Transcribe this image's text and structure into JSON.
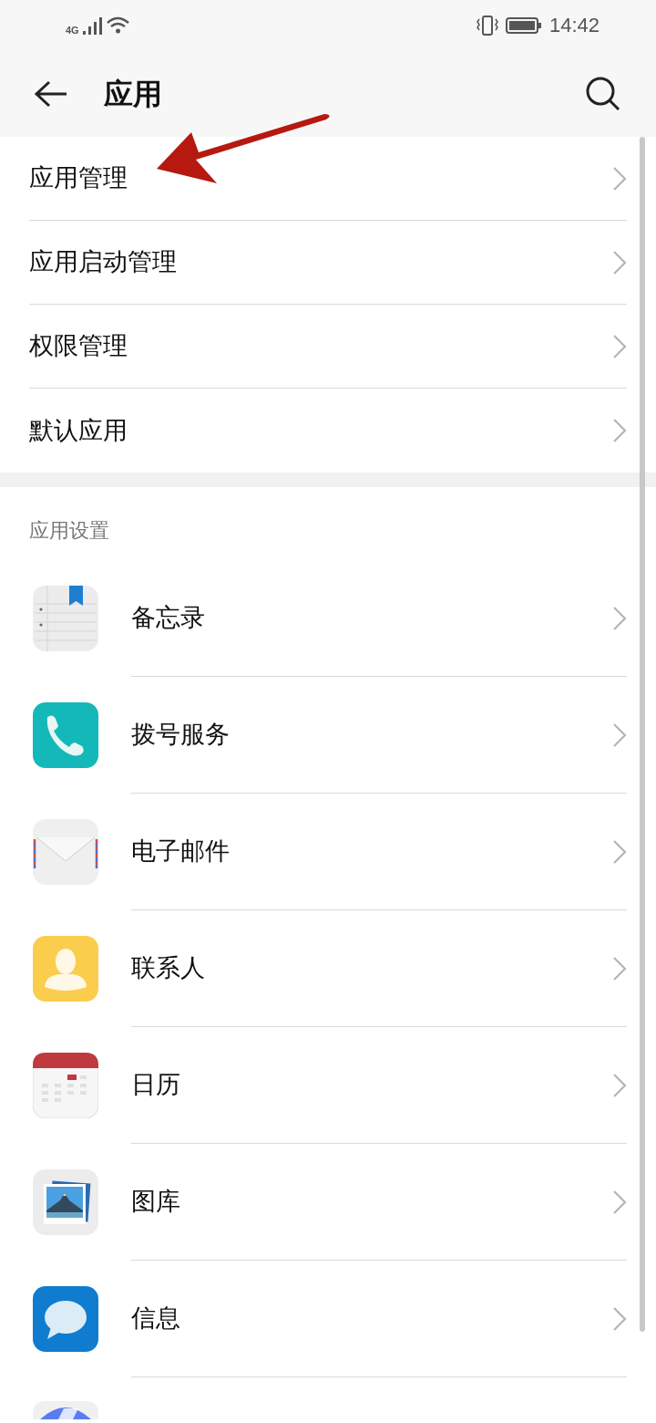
{
  "status_bar": {
    "network": "4G",
    "time": "14:42"
  },
  "header": {
    "title": "应用"
  },
  "menu": [
    {
      "label": "应用管理"
    },
    {
      "label": "应用启动管理"
    },
    {
      "label": "权限管理"
    },
    {
      "label": "默认应用"
    }
  ],
  "section": {
    "title": "应用设置"
  },
  "apps": [
    {
      "kind": "notes",
      "label": "备忘录"
    },
    {
      "kind": "dialer",
      "label": "拨号服务"
    },
    {
      "kind": "email",
      "label": "电子邮件"
    },
    {
      "kind": "contacts",
      "label": "联系人"
    },
    {
      "kind": "calendar",
      "label": "日历"
    },
    {
      "kind": "gallery",
      "label": "图库"
    },
    {
      "kind": "messages",
      "label": "信息"
    },
    {
      "kind": "cut"
    }
  ]
}
